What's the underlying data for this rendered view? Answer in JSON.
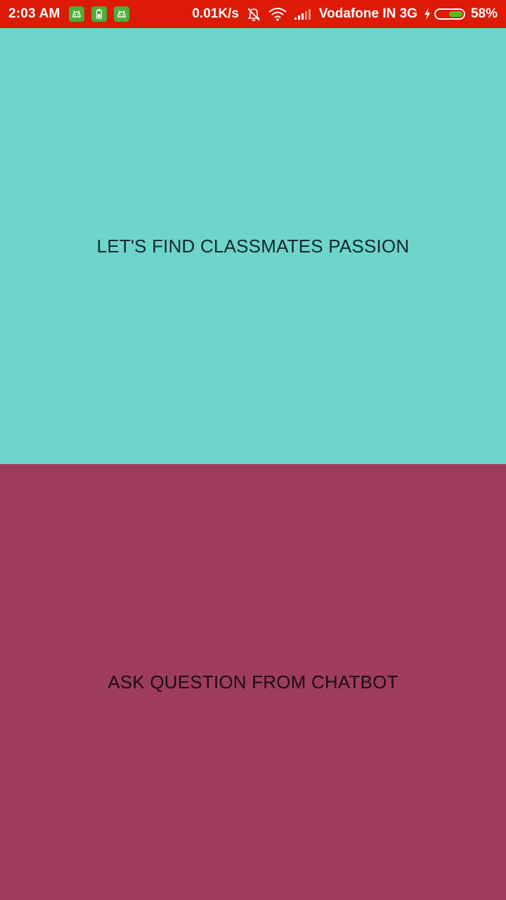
{
  "status_bar": {
    "time": "2:03 AM",
    "notification_icons": [
      "android-app-icon",
      "battery-app-icon",
      "android-app-icon"
    ],
    "net_speed": "0.01K/s",
    "carrier": "Vodafone IN 3G",
    "battery_percent": "58%",
    "battery_level": 0.58,
    "colors": {
      "background": "#dd1a05",
      "notif_icon": "#4caf3a",
      "battery_fill": "#4cc31d"
    }
  },
  "main": {
    "top_button": {
      "label": "LET'S FIND CLASSMATES PASSION",
      "color": "#6dd5cb"
    },
    "bottom_button": {
      "label": "ASK QUESTION FROM CHATBOT",
      "color": "#9e3c60"
    }
  }
}
